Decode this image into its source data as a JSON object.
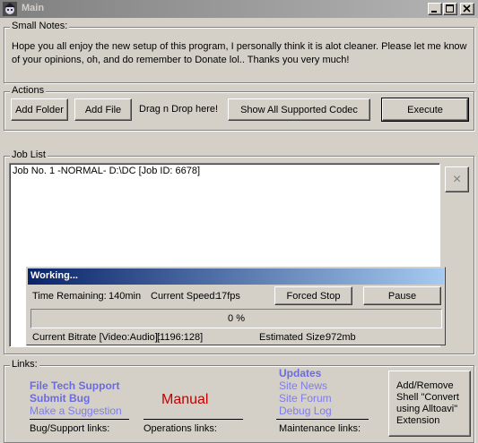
{
  "window": {
    "title": "Main"
  },
  "notes": {
    "label": "Small Notes:",
    "text": "Hope you all enjoy the new setup of this program, I personally think it is alot cleaner. Please let me know of your opinions, oh, and do remember to Donate lol.. Thanks you very much!"
  },
  "actions": {
    "label": "Actions",
    "add_folder": "Add Folder",
    "add_file": "Add File",
    "drag_hint": "Drag n Drop here!",
    "show_codecs": "Show All Supported Codec",
    "execute": "Execute"
  },
  "job_list": {
    "label": "Job List",
    "items": [
      "Job No. 1 -NORMAL- D:\\DC [Job ID:  6678]"
    ],
    "remove_label": "×"
  },
  "working": {
    "title": "Working...",
    "time_remaining_label": "Time Remaining:",
    "time_remaining": "140min",
    "speed_label": "Current Speed:",
    "speed": "17fps",
    "forced_stop": "Forced Stop",
    "pause": "Pause",
    "progress_text": "0 %",
    "progress_value": 0,
    "bitrate_label": "Current Bitrate [Video:Audio]:",
    "bitrate": "[1196:128]",
    "size_label": "Estimated Size:",
    "size": "972mb"
  },
  "links": {
    "label": "Links:",
    "support": {
      "items": [
        "File Tech Support",
        "Submit Bug",
        "Make a Suggestion"
      ],
      "caption": "Bug/Support links:"
    },
    "operations": {
      "manual": "Manual",
      "caption": "Operations links:"
    },
    "maintenance": {
      "items": [
        "Updates",
        "Site News",
        "Site Forum",
        "Debug Log"
      ],
      "caption": "Maintenance links:"
    },
    "shell_button": "Add/Remove Shell \"Convert using Alltoavi\" Extension"
  },
  "colors": {
    "window_bg": "#d4d0c8",
    "title_active_start": "#0a246a",
    "title_active_end": "#a6caf0",
    "link_blue": "#6b6be0",
    "manual_red": "#c00000"
  }
}
